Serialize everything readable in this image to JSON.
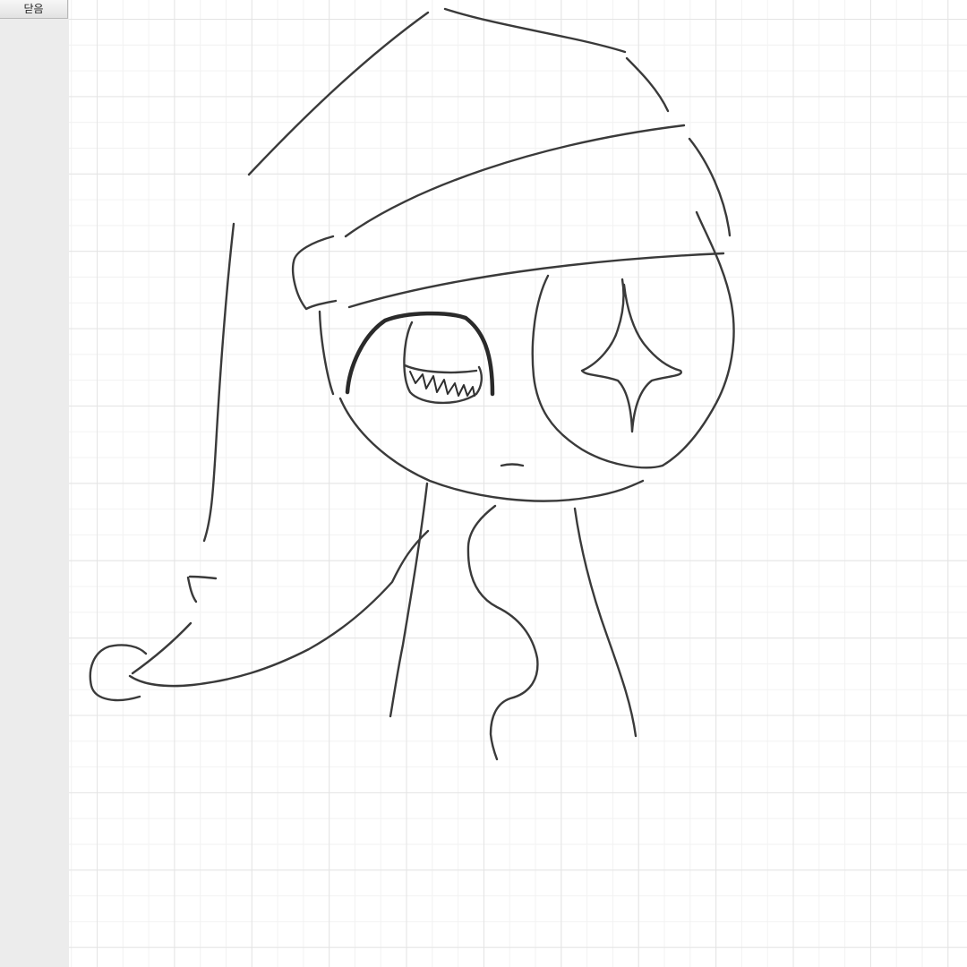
{
  "sidebar": {
    "close_label": "닫음"
  },
  "canvas": {
    "grid_color": "#e4e4e4",
    "stroke_color": "#3a3a3a"
  }
}
